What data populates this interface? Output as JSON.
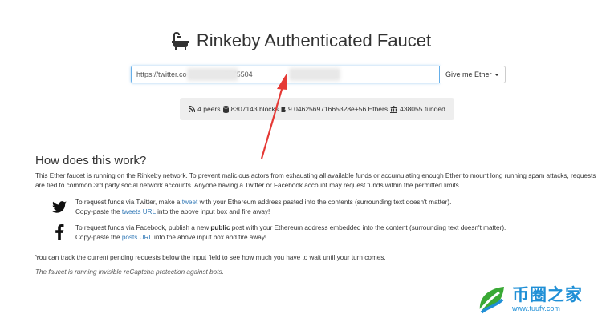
{
  "title": "Rinkeby Authenticated Faucet",
  "request": {
    "url_value": "https://twitter.co          us/137575504                    0",
    "button_label": "Give me Ether"
  },
  "stats": {
    "peers": "4 peers",
    "blocks": "8307143 blocks",
    "ethers": "9.046256971665328e+56 Ethers",
    "funded": "438055 funded"
  },
  "how": {
    "title": "How does this work?",
    "intro": "This Ether faucet is running on the Rinkeby network. To prevent malicious actors from exhausting all available funds or accumulating enough Ether to mount long running spam attacks, requests are tied to common 3rd party social network accounts. Anyone having a Twitter or Facebook account may request funds within the permitted limits.",
    "twitter": {
      "l1_a": "To request funds via Twitter, make a ",
      "l1_link": "tweet",
      "l1_b": " with your Ethereum address pasted into the contents (surrounding text doesn't matter).",
      "l2_a": "Copy-paste the ",
      "l2_link": "tweets URL",
      "l2_b": " into the above input box and fire away!"
    },
    "facebook": {
      "l1_a": "To request funds via Facebook, publish a new ",
      "l1_bold": "public",
      "l1_b": " post with your Ethereum address embedded into the content (surrounding text doesn't matter).",
      "l2_a": "Copy-paste the ",
      "l2_link": "posts URL",
      "l2_b": " into the above input box and fire away!"
    },
    "track": "You can track the current pending requests below the input field to see how much you have to wait until your turn comes.",
    "recaptcha": "The faucet is running invisible reCaptcha protection against bots."
  },
  "watermark": {
    "cn": "币圈之家",
    "url": "www.tuufy.com"
  },
  "icons": {
    "title": "bath-icon",
    "peers": "rss-icon",
    "blocks": "database-icon",
    "ethers": "bitcoin-icon",
    "funded": "bank-icon",
    "twitter": "twitter-icon",
    "facebook": "facebook-icon"
  },
  "colors": {
    "link": "#337ab7",
    "focus": "#66afe9",
    "arrow": "#e53935",
    "watermark": "#1f8fd6"
  }
}
